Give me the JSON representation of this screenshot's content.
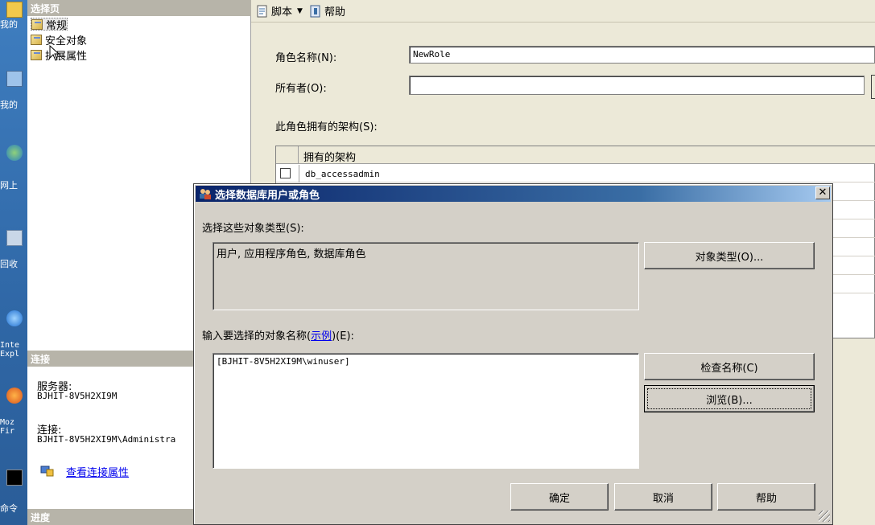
{
  "desktop": {
    "icons": [
      {
        "label": "我的",
        "icon": "folder-icon"
      },
      {
        "label": "我的",
        "icon": "computer-icon"
      },
      {
        "label": "网上",
        "icon": "network-icon"
      },
      {
        "label": "回收",
        "icon": "recycle-bin-icon"
      },
      {
        "label": "Inte",
        "label2": "Expl",
        "icon": "ie-icon"
      },
      {
        "label": "Moz",
        "label2": "Fir",
        "icon": "firefox-icon"
      },
      {
        "label": "命令",
        "icon": "cmd-icon"
      }
    ]
  },
  "left_panel": {
    "select_page_header": "选择页",
    "pages": [
      "常规",
      "安全对象",
      "扩展属性"
    ],
    "connection_header": "连接",
    "server_label": "服务器:",
    "server_value": "BJHIT-8V5H2XI9M",
    "connection_label": "连接:",
    "connection_value": "BJHIT-8V5H2XI9M\\Administra",
    "view_connection_link": "查看连接属性",
    "progress_header": "进度"
  },
  "toolbar": {
    "script_label": "脚本",
    "help_label": "帮助"
  },
  "form": {
    "role_name_label": "角色名称(N):",
    "role_name_value": "NewRole",
    "owner_label": "所有者(O):",
    "owner_value": "",
    "owned_schemas_label": "此角色拥有的架构(S):",
    "grid_header": "拥有的架构",
    "grid_rows": [
      "db_accessadmin"
    ]
  },
  "dialog": {
    "title": "选择数据库用户或角色",
    "object_types_label": "选择这些对象类型(S):",
    "object_types_value": "用户, 应用程序角色, 数据库角色",
    "object_types_button": "对象类型(O)...",
    "enter_names_label_prefix": "输入要选择的对象名称(",
    "enter_names_link": "示例",
    "enter_names_label_suffix": ")(E):",
    "names_value": "[BJHIT-8V5H2XI9M\\winuser]",
    "check_names_button": "检查名称(C)",
    "browse_button": "浏览(B)...",
    "ok_button": "确定",
    "cancel_button": "取消",
    "help_button": "帮助",
    "colors": {
      "title_start": "#0a246a",
      "title_end": "#a6caf0",
      "face": "#d4d0c8"
    }
  }
}
